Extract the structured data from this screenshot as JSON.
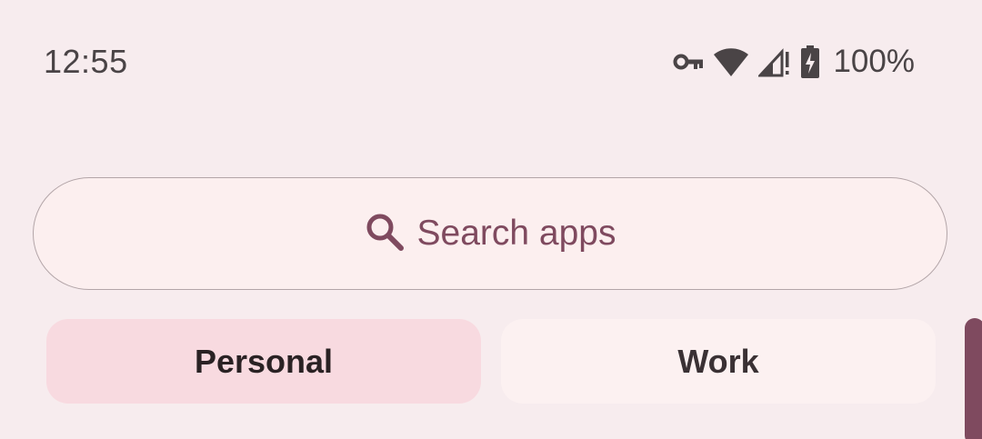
{
  "status_bar": {
    "time": "12:55",
    "battery_percent": "100%",
    "icons": [
      "vpn-key-icon",
      "wifi-icon",
      "signal-no-service-icon",
      "battery-charging-icon"
    ]
  },
  "search": {
    "placeholder": "Search apps",
    "icon": "search-icon"
  },
  "tabs": [
    {
      "label": "Personal",
      "selected": true
    },
    {
      "label": "Work",
      "selected": false
    }
  ],
  "colors": {
    "background": "#f7ecee",
    "accent": "#7f4a5f",
    "tab_selected": "#f8dae0",
    "tab_unselected": "#fcf1f1"
  }
}
